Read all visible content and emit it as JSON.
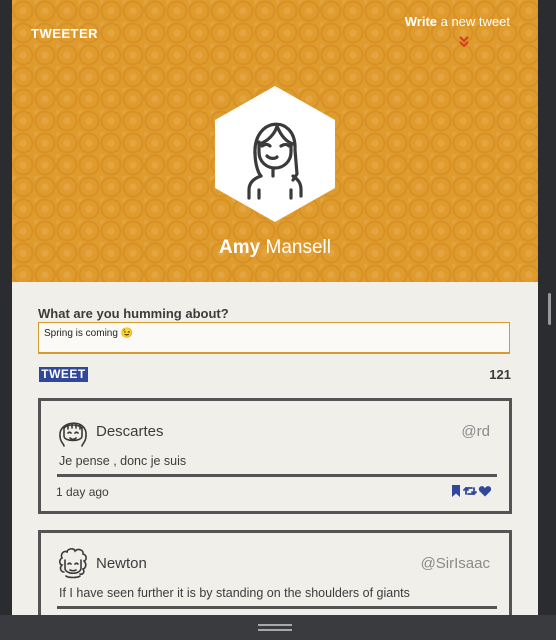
{
  "header": {
    "brand": "TWEETER",
    "write_link_bold": "Write",
    "write_link_rest": " a new tweet",
    "chevron_icon": "double-chevron-down-icon",
    "background_color": "#e09b2d"
  },
  "profile": {
    "first_name": "Amy",
    "last_name": " Mansell",
    "avatar_icon": "user-avatar-icon"
  },
  "compose": {
    "label": "What are you humming about?",
    "value": "Spring is coming 😉",
    "button_label": "TWEET",
    "remaining_chars": "121",
    "button_color": "#31479a"
  },
  "tweets": [
    {
      "name": "Descartes",
      "handle": "@rd",
      "text": "Je pense , donc je suis",
      "time": "1 day ago"
    },
    {
      "name": "Newton",
      "handle": "@SirIsaac",
      "text": "If I have seen further it is by standing on the shoulders of giants"
    }
  ],
  "actions": [
    "bookmark-icon",
    "retweet-icon",
    "heart-icon"
  ],
  "accent_color": "#d59a30",
  "card_border_color": "#545454"
}
